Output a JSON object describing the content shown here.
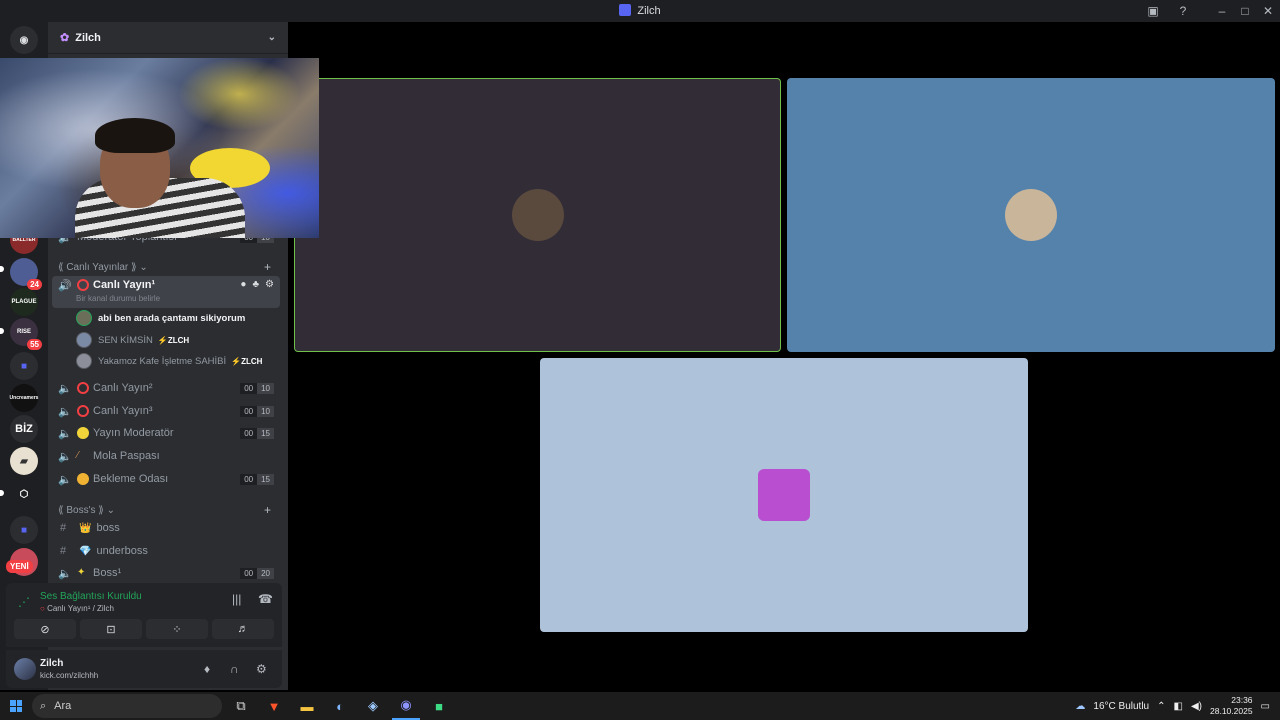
{
  "window": {
    "title": "Zilch"
  },
  "server": {
    "name": "Zilch"
  },
  "guilds": [
    {
      "label": "BALLTER",
      "badge": ""
    },
    {
      "label": "",
      "badge": "24"
    },
    {
      "label": "PLAGUE",
      "badge": ""
    },
    {
      "label": "RISE",
      "badge": "55"
    },
    {
      "label": "",
      "badge": ""
    },
    {
      "label": "Uncreamers",
      "badge": ""
    },
    {
      "label": "BİZ",
      "badge": ""
    },
    {
      "label": "",
      "badge": ""
    },
    {
      "label": "",
      "badge": ""
    },
    {
      "label": "",
      "badge": ""
    },
    {
      "label": "",
      "badge": "YENİ"
    }
  ],
  "partial_channel": {
    "name": "Moderatör Toplantısı",
    "count_a": "00",
    "count_b": "10"
  },
  "categories": {
    "live": "⟪ Canlı Yayınlar ⟫",
    "boss": "⟪ Boss's ⟫"
  },
  "active_channel": {
    "name": "Canlı Yayın¹",
    "subtitle": "Bir kanal durumu belirle"
  },
  "members": [
    {
      "name": "abi ben arada çantamı sikiyorum",
      "tag": ""
    },
    {
      "name": "SEN KİMSİN",
      "tag": "⚡ZLCH"
    },
    {
      "name": "Yakamoz Kafe İşletme SAHİBİ",
      "tag": "⚡ZLCH"
    }
  ],
  "voice_channels": [
    {
      "name": "Canlı Yayın²",
      "count_a": "00",
      "count_b": "10",
      "emoji_color": "#f23f43"
    },
    {
      "name": "Canlı Yayın³",
      "count_a": "00",
      "count_b": "10",
      "emoji_color": "#f23f43"
    },
    {
      "name": "Yayın Moderatör",
      "count_a": "00",
      "count_b": "15",
      "emoji_color": "#f0d43a"
    },
    {
      "name": "Mola Paspası",
      "count_a": "",
      "count_b": "",
      "emoji_color": "#c58b4e"
    },
    {
      "name": "Bekleme Odası",
      "count_a": "00",
      "count_b": "15",
      "emoji_color": "#f0b232"
    }
  ],
  "text_channels": [
    {
      "name": "boss",
      "emoji": "👑"
    },
    {
      "name": "underboss",
      "emoji": "💎"
    }
  ],
  "boss_voice": {
    "name": "Boss¹",
    "count_a": "00",
    "count_b": "20"
  },
  "voice_status": {
    "title": "Ses Bağlantısı Kuruldu",
    "channel": "Canlı Yayın¹ / Zilch"
  },
  "user": {
    "name": "Zilch",
    "status": "kick.com/zilchhh"
  },
  "tiles": [
    {
      "bg": "#312c36",
      "border": "#6fbf4a",
      "avatar": "#5a4a3e"
    },
    {
      "bg": "#5582ab",
      "border": "",
      "avatar": "#c9b59a"
    },
    {
      "bg": "#aec3da",
      "border": "",
      "avatar": "#b94fd0"
    }
  ],
  "taskbar": {
    "search": "Ara",
    "weather": "16°C  Bulutlu",
    "time": "23:36",
    "date": "28.10.2025"
  },
  "colors": {
    "accent": "#5865f2",
    "online": "#23a55a"
  }
}
